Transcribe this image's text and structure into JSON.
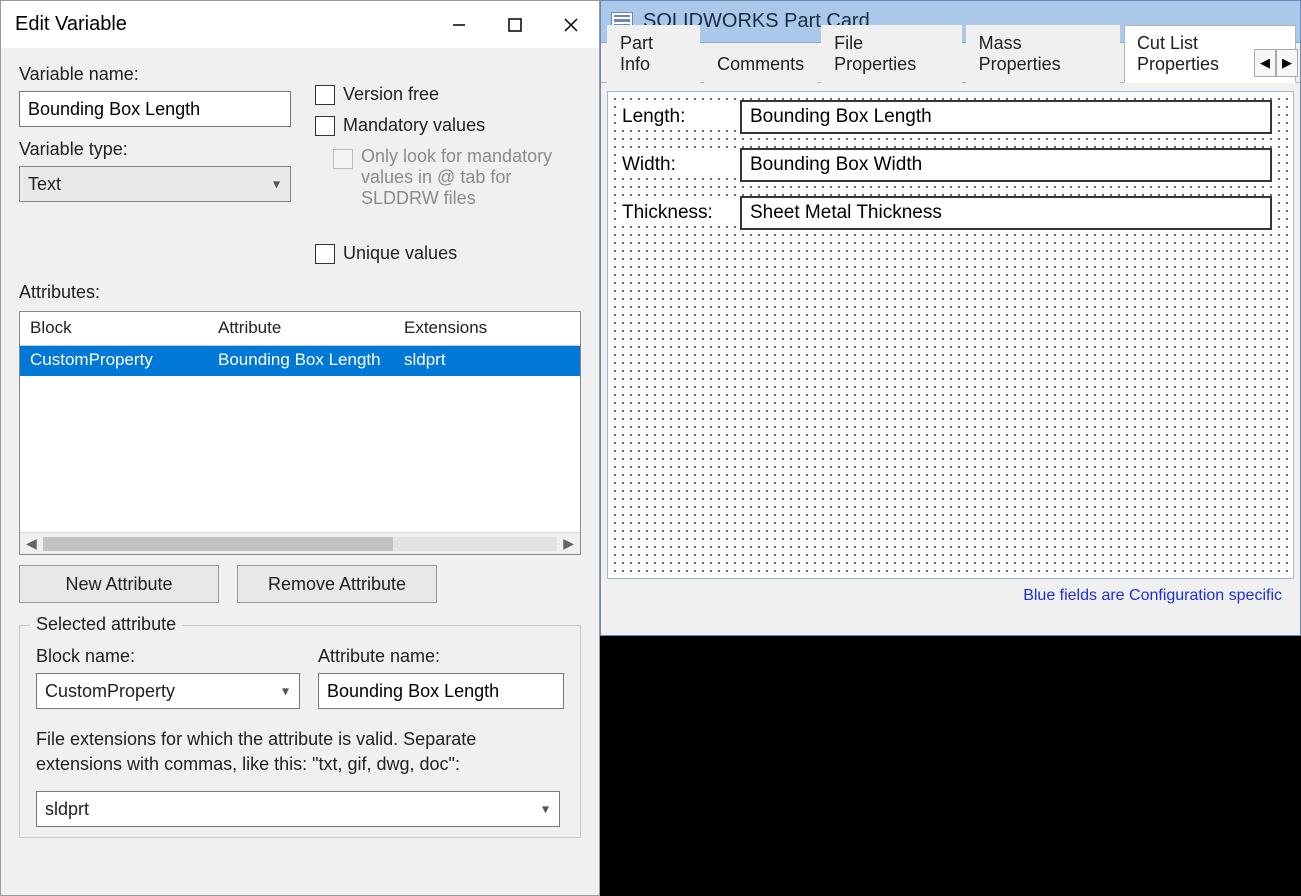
{
  "editVariable": {
    "title": "Edit Variable",
    "variableNameLabel": "Variable name:",
    "variableNameValue": "Bounding Box Length",
    "variableTypeLabel": "Variable type:",
    "variableTypeValue": "Text",
    "versionFreeLabel": "Version free",
    "mandatoryValuesLabel": "Mandatory values",
    "mandatoryNote": "Only look for mandatory values in @ tab for SLDDRW files",
    "uniqueValuesLabel": "Unique values",
    "attributesLabel": "Attributes:",
    "gridHeaders": {
      "block": "Block",
      "attribute": "Attribute",
      "extensions": "Extensions"
    },
    "gridRow": {
      "block": "CustomProperty",
      "attribute": "Bounding Box Length",
      "extensions": "sldprt"
    },
    "newAttributeBtn": "New Attribute",
    "removeAttributeBtn": "Remove Attribute",
    "selectedAttribute": {
      "legend": "Selected attribute",
      "blockNameLabel": "Block name:",
      "blockNameValue": "CustomProperty",
      "attributeNameLabel": "Attribute name:",
      "attributeNameValue": "Bounding Box Length",
      "extensionsNote": "File extensions for which the attribute is valid. Separate extensions with commas, like this: \"txt, gif, dwg, doc\":",
      "extensionsValue": "sldprt"
    }
  },
  "partCard": {
    "title": "SOLIDWORKS Part Card",
    "tabs": [
      "Part Info",
      "Comments",
      "File Properties",
      "Mass Properties",
      "Cut List Properties"
    ],
    "activeTabIndex": 4,
    "fields": [
      {
        "label": "Length:",
        "value": "Bounding Box Length"
      },
      {
        "label": "Width:",
        "value": "Bounding Box Width"
      },
      {
        "label": "Thickness:",
        "value": "Sheet Metal Thickness"
      }
    ],
    "footerNote": "Blue fields are Configuration specific"
  }
}
